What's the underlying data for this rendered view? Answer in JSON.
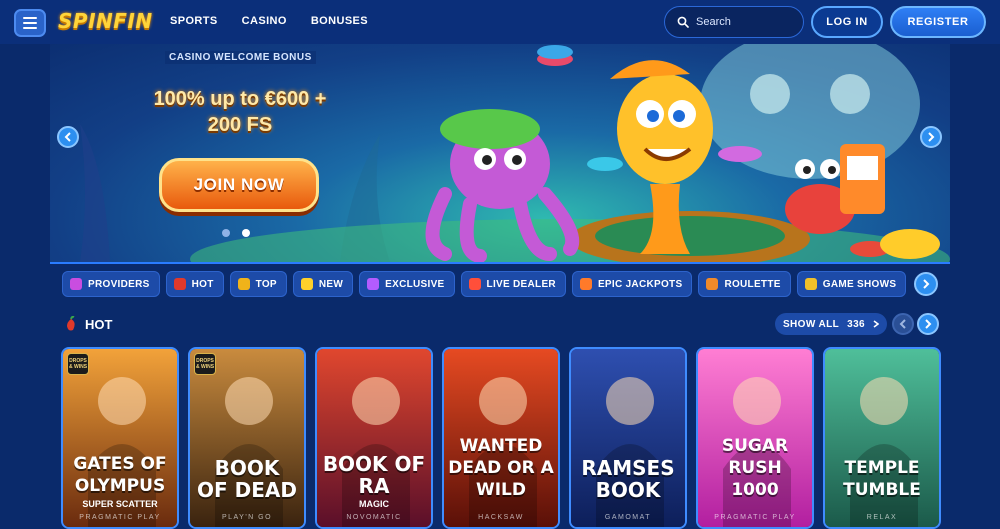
{
  "header": {
    "logo": "SPINFIN",
    "nav": [
      "SPORTS",
      "CASINO",
      "BONUSES"
    ],
    "search_placeholder": "Search",
    "login_label": "LOG IN",
    "register_label": "REGISTER"
  },
  "banner": {
    "tag": "CASINO WELCOME BONUS",
    "bonus_line1": "100% up to €600 +",
    "bonus_line2": "200 FS",
    "cta": "JOIN NOW",
    "slides": 2,
    "active_slide": 1
  },
  "categories": [
    {
      "label": "PROVIDERS",
      "icon": "providers-icon",
      "color": "#c94de0"
    },
    {
      "label": "HOT",
      "icon": "chili-icon",
      "color": "#e0392b"
    },
    {
      "label": "TOP",
      "icon": "crown-icon",
      "color": "#f0b31a"
    },
    {
      "label": "NEW",
      "icon": "lightning-icon",
      "color": "#ffd02a"
    },
    {
      "label": "EXCLUSIVE",
      "icon": "gem-icon",
      "color": "#b35cff"
    },
    {
      "label": "LIVE DEALER",
      "icon": "chip-icon",
      "color": "#ff4f3a"
    },
    {
      "label": "EPIC JACKPOTS",
      "icon": "bomb-icon",
      "color": "#ff7a2a"
    },
    {
      "label": "ROULETTE",
      "icon": "roulette-icon",
      "color": "#f08a2a"
    },
    {
      "label": "GAME SHOWS",
      "icon": "gameshow-icon",
      "color": "#f0c02a"
    }
  ],
  "section": {
    "title": "HOT",
    "show_all": "SHOW ALL",
    "count": "336"
  },
  "games": [
    {
      "name": "GATES OF\nOLYMPUS",
      "sub": "SUPER SCATTER",
      "provider": "PRAGMATIC PLAY",
      "badge": "DROPS & WINS",
      "bg1": "#f2a23a",
      "bg2": "#6a2b0e"
    },
    {
      "name": "BOOK\nOF DEAD",
      "sub": "",
      "provider": "PLAY'N GO",
      "badge": "DROPS & WINS",
      "bg1": "#c98b3e",
      "bg2": "#3a230f"
    },
    {
      "name": "BOOK OF RA",
      "sub": "MAGIC",
      "provider": "NOVOMATIC",
      "badge": "",
      "bg1": "#e0472e",
      "bg2": "#5a0f2a"
    },
    {
      "name": "WANTED\nDEAD OR A WILD",
      "sub": "",
      "provider": "HACKSAW",
      "badge": "",
      "bg1": "#e64a22",
      "bg2": "#5a1008"
    },
    {
      "name": "RAMSES BOOK",
      "sub": "",
      "provider": "GAMOMAT",
      "badge": "",
      "bg1": "#2e4fb0",
      "bg2": "#0d1f5a"
    },
    {
      "name": "SUGAR RUSH\n1000",
      "sub": "",
      "provider": "PRAGMATIC PLAY",
      "badge": "",
      "bg1": "#ff7ed3",
      "bg2": "#b21fa0"
    },
    {
      "name": "TEMPLE\nTUMBLE",
      "sub": "",
      "provider": "RELAX",
      "badge": "",
      "bg1": "#4fbf9a",
      "bg2": "#1b5a4a"
    }
  ],
  "colors": {
    "accent": "#2d8ff0",
    "background": "#0a2a6b",
    "cta": "#e85a0d"
  }
}
